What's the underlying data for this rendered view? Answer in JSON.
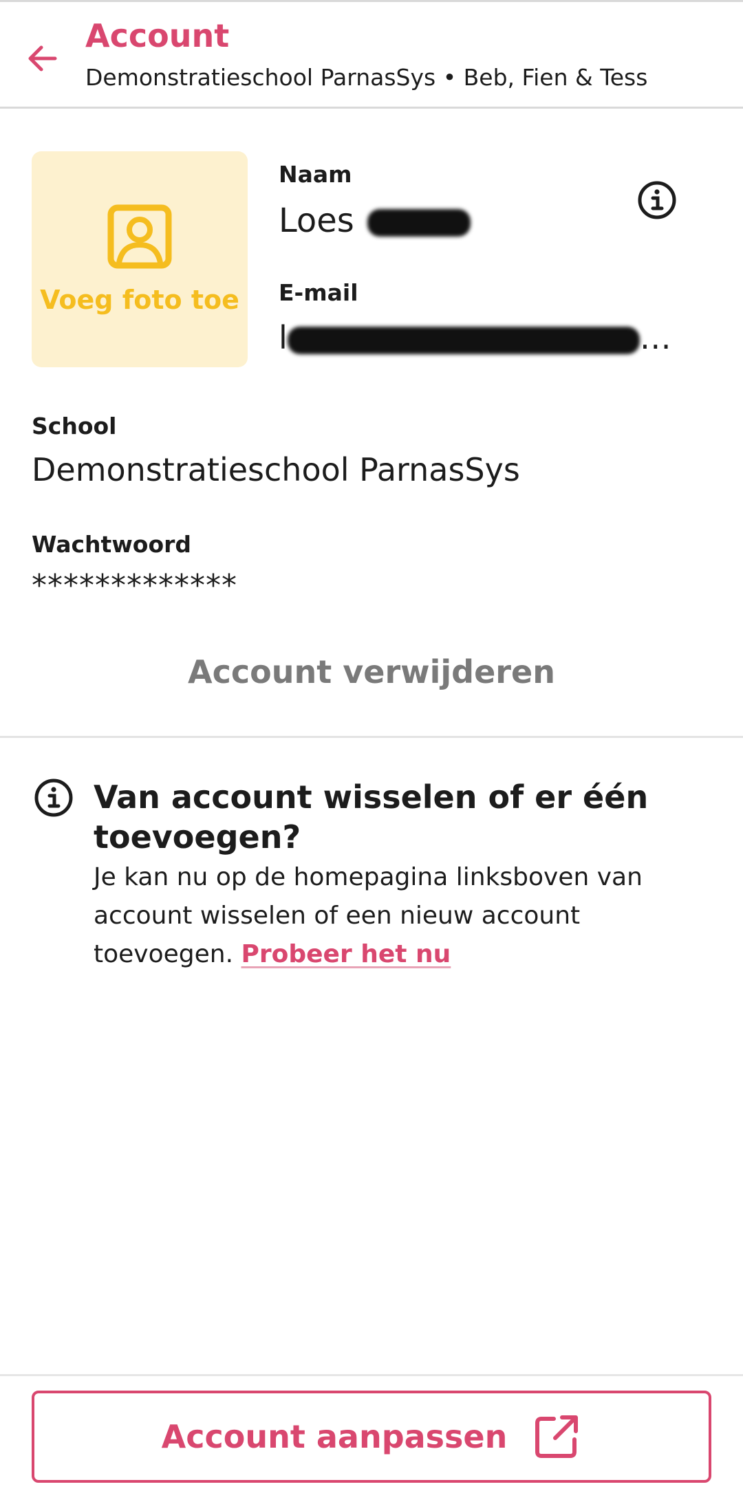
{
  "colors": {
    "accent": "#d9476f",
    "photo_bg": "#fdf1cf",
    "photo_accent": "#f5bd1f",
    "muted": "#7a7a7a"
  },
  "header": {
    "title": "Account",
    "subtitle": "Demonstratieschool ParnasSys • Beb, Fien & Tess",
    "back_icon": "arrow-left-icon"
  },
  "profile": {
    "photo_label": "Voeg foto toe",
    "photo_icon": "portrait-icon",
    "name_label": "Naam",
    "name_value": "Loes",
    "email_label": "E-mail",
    "email_value_prefix": "l",
    "email_value_suffix": "…",
    "info_icon": "info-icon"
  },
  "school": {
    "label": "School",
    "value": "Demonstratieschool ParnasSys"
  },
  "password": {
    "label": "Wachtwoord",
    "value": "*************"
  },
  "delete_account_label": "Account verwijderen",
  "notice": {
    "icon": "info-icon",
    "title": "Van account wisselen of er één toevoegen?",
    "body": "Je kan nu op de homepagina linksboven van account wisselen of een nieuw account toevoegen.",
    "link": "Probeer het nu"
  },
  "footer": {
    "button_label": "Account aanpassen",
    "button_icon": "external-link-icon"
  }
}
